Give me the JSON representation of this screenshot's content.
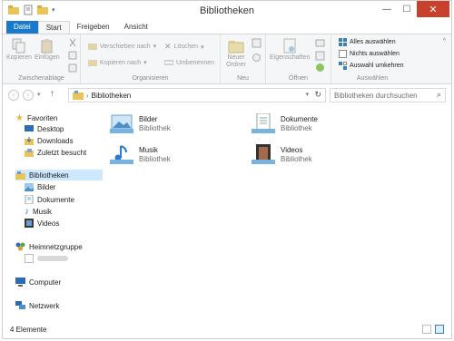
{
  "window": {
    "title": "Bibliotheken"
  },
  "tabs": [
    {
      "label": "Datei"
    },
    {
      "label": "Start"
    },
    {
      "label": "Freigeben"
    },
    {
      "label": "Ansicht"
    }
  ],
  "ribbon": {
    "clipboard": {
      "label": "Zwischenablage",
      "copy": "Kopieren",
      "paste": "Einfügen"
    },
    "organize": {
      "label": "Organisieren",
      "move": "Verschieben nach",
      "copyto": "Kopieren nach",
      "delete": "Löschen",
      "rename": "Umbenennen"
    },
    "new": {
      "label": "Neu",
      "newfolder": "Neuer Ordner"
    },
    "open": {
      "label": "Öffnen",
      "properties": "Eigenschaften"
    },
    "select": {
      "label": "Auswählen",
      "all": "Alles auswählen",
      "none": "Nichts auswählen",
      "invert": "Auswahl umkehren"
    }
  },
  "address": {
    "path": "Bibliotheken",
    "search_placeholder": "Bibliotheken durchsuchen"
  },
  "navpane": {
    "favorites": "Favoriten",
    "desktop": "Desktop",
    "downloads": "Downloads",
    "recent": "Zuletzt besucht",
    "libraries": "Bibliotheken",
    "pictures": "Bilder",
    "documents": "Dokumente",
    "music": "Musik",
    "videos": "Videos",
    "homegroup": "Heimnetzgruppe",
    "computer": "Computer",
    "network": "Netzwerk"
  },
  "libraries": [
    {
      "name": "Bilder",
      "type": "Bibliothek"
    },
    {
      "name": "Dokumente",
      "type": "Bibliothek"
    },
    {
      "name": "Musik",
      "type": "Bibliothek"
    },
    {
      "name": "Videos",
      "type": "Bibliothek"
    }
  ],
  "status": {
    "count": "4 Elemente"
  }
}
